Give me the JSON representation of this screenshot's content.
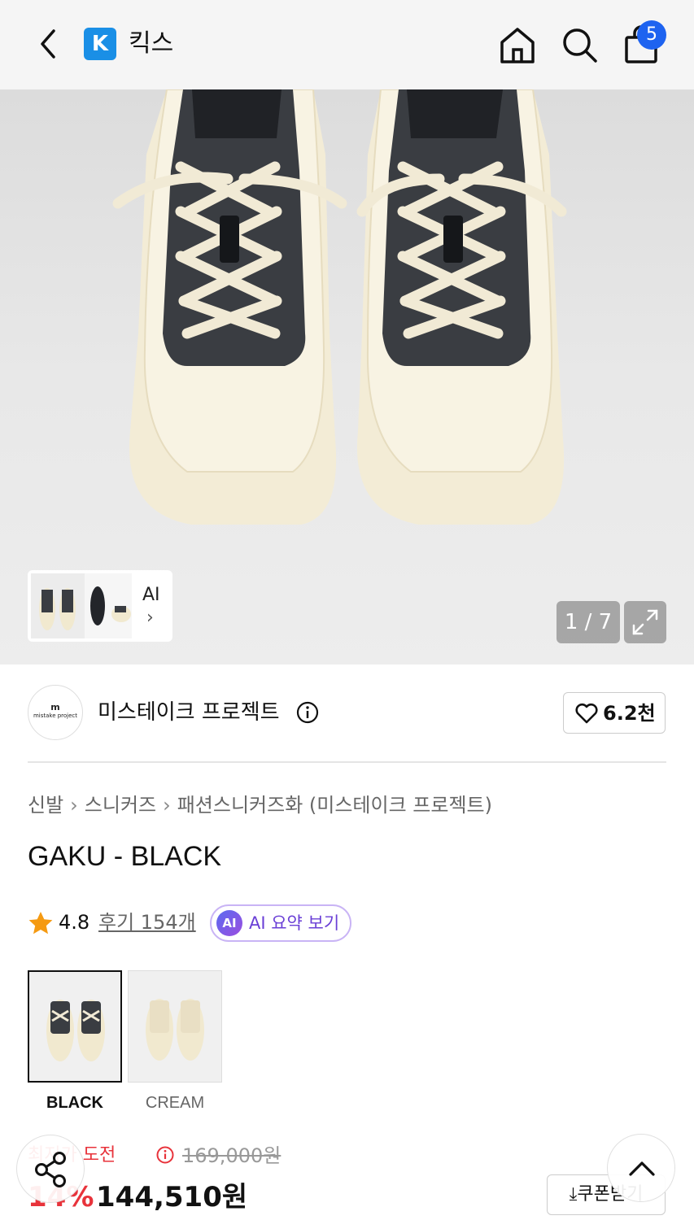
{
  "header": {
    "app_logo_letter": "K",
    "app_name": "킥스",
    "cart_count": "5"
  },
  "gallery": {
    "ai_label": "AI",
    "counter": "1 / 7"
  },
  "brand": {
    "logo_mark": "m",
    "logo_text": "mistake project",
    "name": "미스테이크 프로젝트",
    "likes": "6.2천"
  },
  "breadcrumb": [
    "신발",
    "스니커즈",
    "패션스니커즈화 (미스테이크 프로젝트)"
  ],
  "product": {
    "title": "GAKU - BLACK",
    "rating": "4.8",
    "review_label": "후기 154개",
    "ai_badge": "AI",
    "ai_summary_label": "AI 요약 보기"
  },
  "colors": [
    {
      "label": "BLACK",
      "selected": true
    },
    {
      "label": "CREAM",
      "selected": false
    }
  ],
  "price": {
    "challenge_label": "최저가 도전",
    "original": "169,000원",
    "discount": "14%",
    "sale": "144,510원",
    "coupon_label": "쿠폰받기"
  },
  "theme": {
    "accent_blue": "#1e63f0",
    "sale_red": "#e8333b",
    "ai_purple": "#6a3fd6"
  }
}
